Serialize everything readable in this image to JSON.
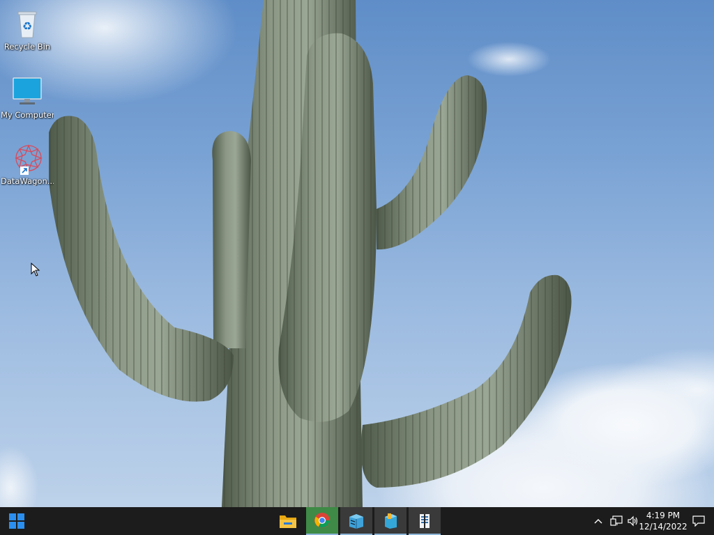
{
  "desktop": {
    "icons": [
      {
        "label": "Recycle Bin",
        "icon": "recycle-bin-icon"
      },
      {
        "label": "My Computer",
        "icon": "monitor-icon"
      },
      {
        "label": "DataWagon...",
        "icon": "datawagon-icon"
      }
    ]
  },
  "taskbar": {
    "apps": [
      {
        "name": "File Explorer",
        "icon": "folder-icon"
      },
      {
        "name": "Google Chrome",
        "icon": "chrome-icon"
      },
      {
        "name": "Server Manager",
        "icon": "server-manager-icon"
      },
      {
        "name": "Server Tool",
        "icon": "server-tool-icon"
      },
      {
        "name": "Storage Tool",
        "icon": "storage-icon"
      }
    ],
    "clock": {
      "time": "4:19 PM",
      "date": "12/14/2022"
    }
  },
  "colors": {
    "taskbar": "#1c1c1c",
    "accent": "#3f8a46",
    "start": "#2b8ff0"
  }
}
